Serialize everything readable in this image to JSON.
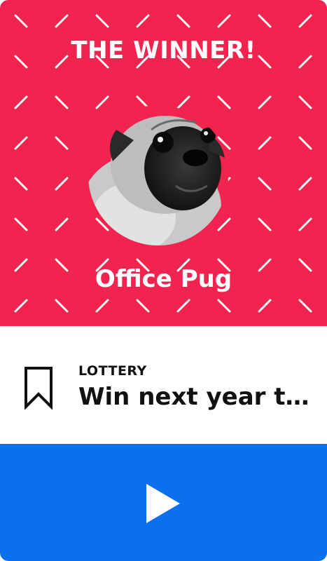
{
  "hero": {
    "headline": "THE WINNER!",
    "name": "Office Pug",
    "background_color": "#f0244f",
    "photo_alt": "Office Pug"
  },
  "info": {
    "category": "LOTTERY",
    "title": "Win next year ti…",
    "bookmark_icon": "bookmark-icon"
  },
  "play": {
    "icon": "play-icon",
    "background_color": "#0b6ff0"
  }
}
